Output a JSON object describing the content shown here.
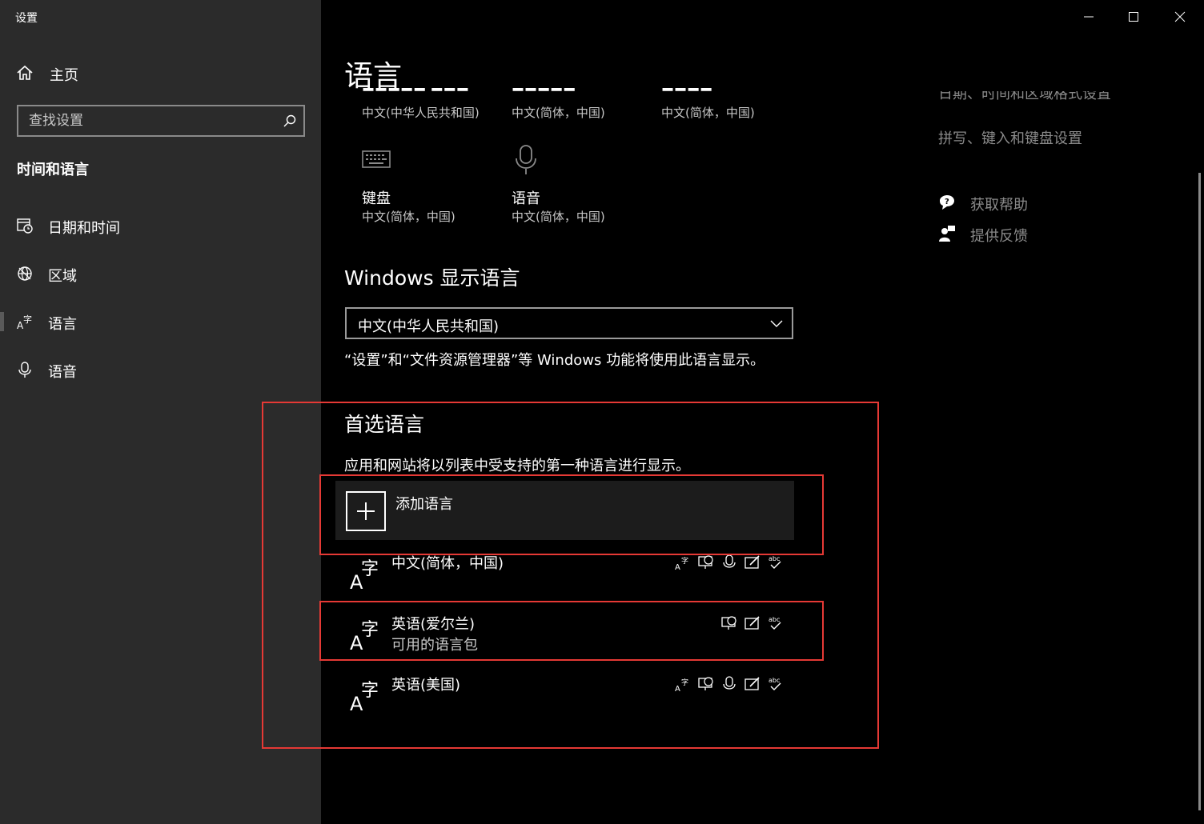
{
  "window": {
    "title": "设置"
  },
  "sidebar": {
    "home_label": "主页",
    "search_placeholder": "查找设置",
    "section_header": "时间和语言",
    "items": [
      {
        "label": "日期和时间",
        "icon": "calendar-clock-icon"
      },
      {
        "label": "区域",
        "icon": "globe-icon"
      },
      {
        "label": "语言",
        "icon": "language-icon",
        "active": true
      },
      {
        "label": "语音",
        "icon": "microphone-icon"
      }
    ]
  },
  "main": {
    "page_title": "语言",
    "top_tiles": [
      {
        "value": "中文(中华人民共和国)"
      },
      {
        "value": "中文(简体，中国)"
      },
      {
        "value": "中文(简体，中国)"
      }
    ],
    "bottom_tiles": [
      {
        "label": "键盘",
        "value": "中文(简体，中国)",
        "icon": "keyboard-icon"
      },
      {
        "label": "语音",
        "value": "中文(简体，中国)",
        "icon": "microphone-icon"
      }
    ],
    "display_language": {
      "heading": "Windows 显示语言",
      "selected": "中文(中华人民共和国)",
      "description": "“设置”和“文件资源管理器”等 Windows 功能将使用此语言显示。"
    },
    "preferred": {
      "heading": "首选语言",
      "description": "应用和网站将以列表中受支持的第一种语言进行显示。",
      "add_label": "添加语言",
      "languages": [
        {
          "name": "中文(简体，中国)",
          "sub": "",
          "features": [
            "display-language-icon",
            "text-to-speech-icon",
            "speech-recognition-icon",
            "handwriting-icon",
            "spellcheck-icon"
          ]
        },
        {
          "name": "英语(爱尔兰)",
          "sub": "可用的语言包",
          "features": [
            "text-to-speech-icon",
            "handwriting-icon",
            "spellcheck-icon"
          ]
        },
        {
          "name": "英语(美国)",
          "sub": "",
          "features": [
            "display-language-icon",
            "text-to-speech-icon",
            "speech-recognition-icon",
            "handwriting-icon",
            "spellcheck-icon"
          ]
        }
      ]
    }
  },
  "right": {
    "cut_link": "日期、时间和区域格式设置",
    "links": [
      "拼写、键入和键盘设置"
    ],
    "help": "获取帮助",
    "feedback": "提供反馈"
  },
  "accent": {
    "highlight_box": "#e53935",
    "sidebar_bg": "#2b2b2b",
    "main_bg": "#000000"
  }
}
